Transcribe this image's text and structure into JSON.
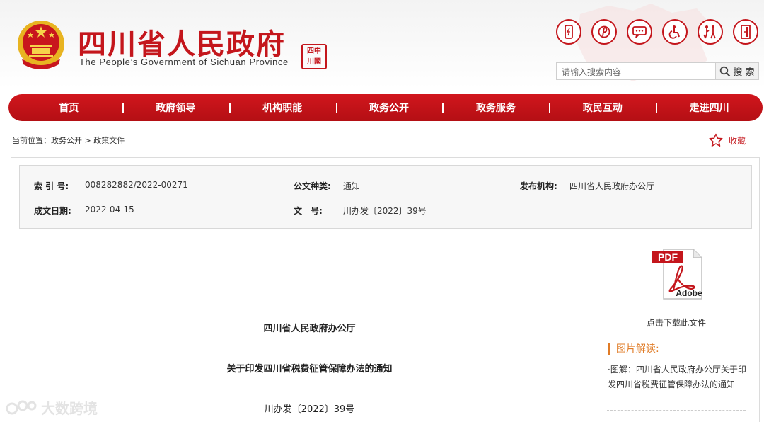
{
  "header": {
    "title": "四川省人民政府",
    "subtitle": "The People’s Government of Sichuan Province",
    "seal_lines": [
      "四中",
      "川國"
    ]
  },
  "tools": {
    "icons": [
      "mobile-icon",
      "weibo-icon",
      "wechat-icon",
      "accessibility-icon",
      "elderly-care-icon",
      "exit-icon"
    ]
  },
  "search": {
    "placeholder": "请输入搜索内容",
    "button_label": "搜 索"
  },
  "nav": {
    "items": [
      "首页",
      "政府领导",
      "机构职能",
      "政务公开",
      "政务服务",
      "政民互动",
      "走进四川"
    ]
  },
  "breadcrumb": {
    "prefix": "当前位置：",
    "items": [
      "政务公开",
      "政策文件"
    ],
    "separator": ">"
  },
  "favorite": {
    "label": "收藏"
  },
  "meta": {
    "index_label": "索 引 号:",
    "index_value": "008282882/2022-00271",
    "type_label": "公文种类:",
    "type_value": "通知",
    "issuer_label": "发布机构:",
    "issuer_value": "四川省人民政府办公厅",
    "date_label": "成文日期:",
    "date_value": "2022-04-15",
    "docno_label": "文　号:",
    "docno_value": "川办发〔2022〕39号"
  },
  "document": {
    "issuer": "四川省人民政府办公厅",
    "title": "关于印发四川省税费征管保障办法的通知",
    "number": "川办发〔2022〕39号"
  },
  "download": {
    "badge": "PDF",
    "brand": "Adobe",
    "caption": "点击下载此文件"
  },
  "interpretation": {
    "heading": "图片解读:",
    "link_text": "·图解：四川省人民政府办公厅关于印发四川省税费征管保障办法的通知"
  },
  "watermark": {
    "text": "大数跨境"
  },
  "colors": {
    "brand_red": "#c4161c",
    "accent_orange": "#e07b26",
    "meta_background": "#f7f7f7"
  }
}
